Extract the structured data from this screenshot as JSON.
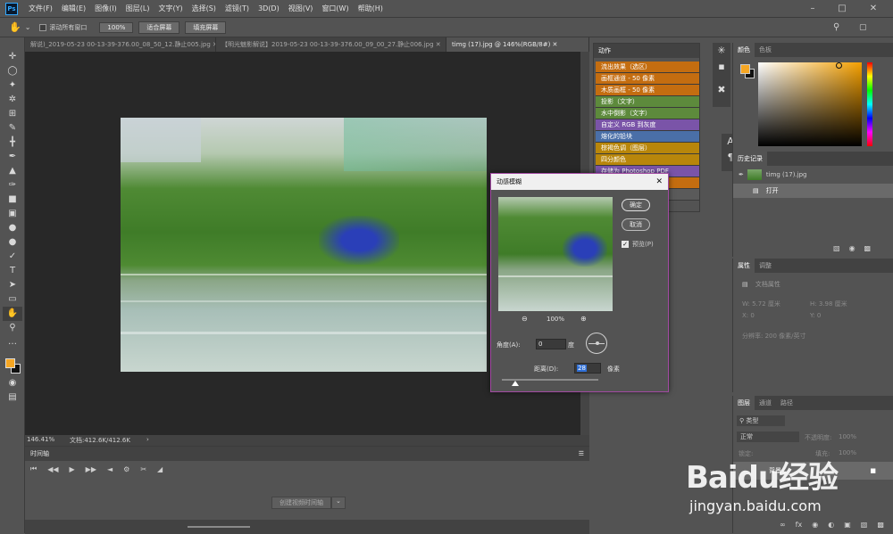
{
  "app": {
    "logo": "Ps"
  },
  "menu": [
    "文件(F)",
    "编辑(E)",
    "图像(I)",
    "图层(L)",
    "文字(Y)",
    "选择(S)",
    "滤镜(T)",
    "3D(D)",
    "视图(V)",
    "窗口(W)",
    "帮助(H)"
  ],
  "options": {
    "scroll_all": "滚动所有窗口",
    "zoom": "100%",
    "fit_screen": "适合屏幕",
    "fill_screen": "填充屏幕"
  },
  "tabs": [
    {
      "label": "解说)_2019-05-23 00-13-39-376.00_08_50_12.静止005.jpg"
    },
    {
      "label": "【明光魅影解说】2019-05-23 00-13-39-376.00_09_00_27.静止006.jpg"
    },
    {
      "label": "timg (17).jpg @ 146%(RGB/8#)"
    }
  ],
  "status": {
    "zoom": "146.41%",
    "doc": "文档:412.6K/412.6K"
  },
  "timeline": {
    "title": "时间轴",
    "create_btn": "创建视频时间轴"
  },
  "actions": {
    "title": "动作",
    "items": [
      {
        "label": "流出效果（选区）",
        "color": "#c46d10"
      },
      {
        "label": "画框通道 - 50 像素",
        "color": "#c46d10"
      },
      {
        "label": "木质画框 - 50 像素",
        "color": "#c46d10"
      },
      {
        "label": "投影（文字）",
        "color": "#5d8a3c"
      },
      {
        "label": "水中倒影（文字）",
        "color": "#5d8a3c"
      },
      {
        "label": "自定义 RGB 到灰度",
        "color": "#7a54a8"
      },
      {
        "label": "熔化的铅块",
        "color": "#4a6fa8"
      },
      {
        "label": "棕褐色调（图层）",
        "color": "#b8860b"
      },
      {
        "label": "四分颜色",
        "color": "#b8860b"
      },
      {
        "label": "存储为 Photoshop PDF",
        "color": "#7a54a8"
      },
      {
        "label": "",
        "color": "#c46d10"
      },
      {
        "label": "",
        "color": "#5a5a5a"
      }
    ]
  },
  "color_panel": {
    "tab1": "颜色",
    "tab2": "色板",
    "fg": "#f5a623",
    "bg": "#111111"
  },
  "history": {
    "title": "历史记录",
    "snapshot": "timg (17).jpg",
    "step": "打开"
  },
  "properties": {
    "tab1": "属性",
    "tab2": "调整",
    "doc_props": "文档属性",
    "w": "W: 5.72 厘米",
    "h": "H: 3.98 厘米",
    "x": "X: 0",
    "y": "Y: 0",
    "resolution": "分辨率: 200 像素/英寸"
  },
  "layers": {
    "tab1": "图层",
    "tab2": "通道",
    "tab3": "路径",
    "kind": "类型",
    "blend": "正常",
    "opacity_label": "不透明度:",
    "opacity": "100%",
    "lock": "锁定:",
    "fill_label": "填充:",
    "fill": "100%",
    "layer_name": "背景"
  },
  "dialog": {
    "title": "动感模糊",
    "ok": "确定",
    "cancel": "取消",
    "preview": "预览(P)",
    "zoom": "100%",
    "angle_label": "角度(A):",
    "angle": "0",
    "angle_unit": "度",
    "distance_label": "距离(D):",
    "distance": "28",
    "distance_unit": "像素"
  },
  "watermark": {
    "brand": "Baidu经验",
    "url": "jingyan.baidu.com"
  }
}
